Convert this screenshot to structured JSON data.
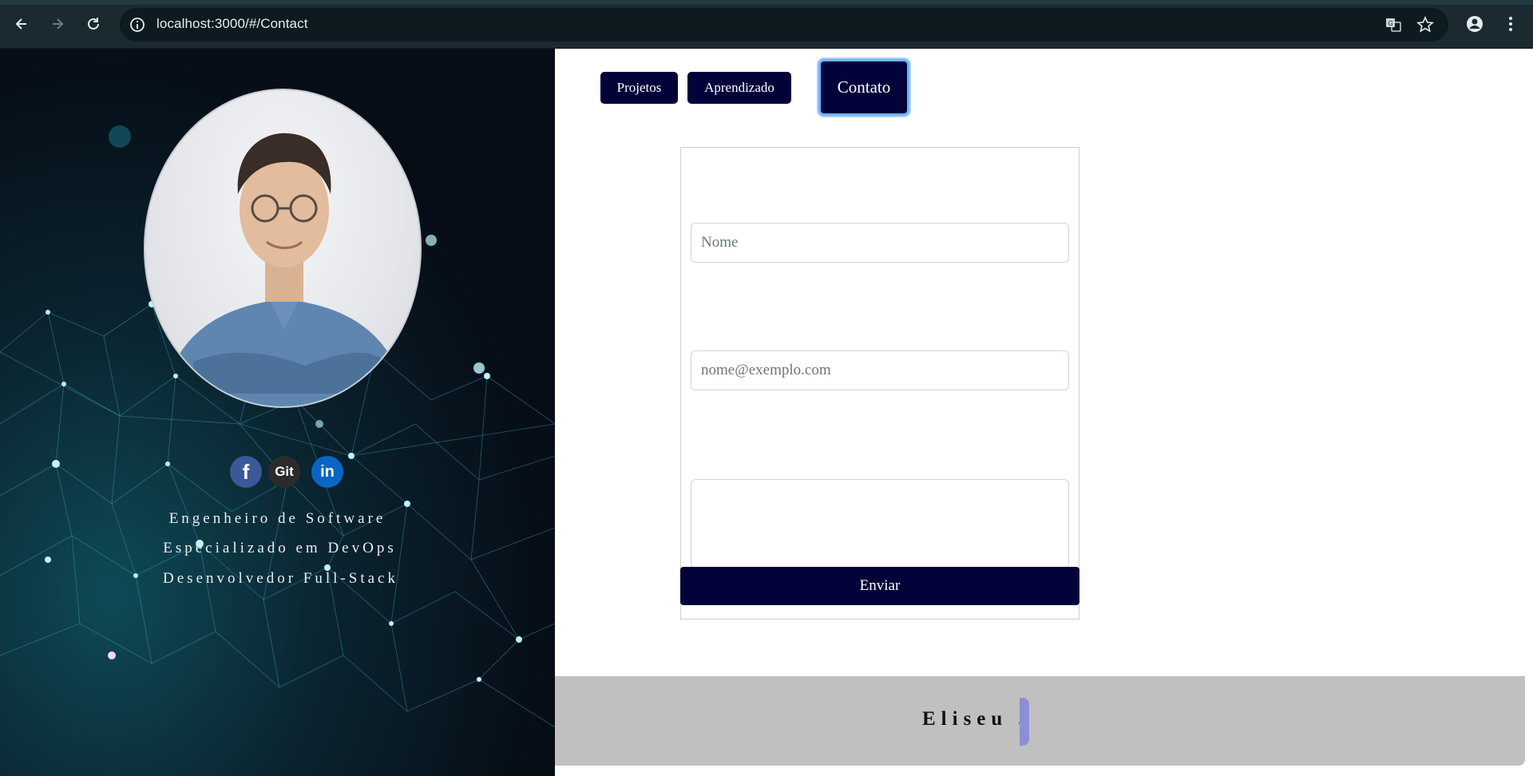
{
  "browser": {
    "url": "localhost:3000/#/Contact",
    "icons": {
      "back": "arrow-left-icon",
      "forward": "arrow-right-icon",
      "reload": "reload-icon",
      "site_info": "info-icon",
      "translate": "translate-icon",
      "bookmark": "star-icon",
      "profile": "person-icon",
      "menu": "kebab-menu-icon"
    }
  },
  "sidebar": {
    "social": [
      {
        "name": "facebook",
        "label": "f",
        "color": "#3b5998"
      },
      {
        "name": "git",
        "label": "Git",
        "color": "#2b2b2b"
      },
      {
        "name": "linkedin",
        "label": "in",
        "color": "#0a66c2"
      }
    ],
    "taglines": [
      "Engenheiro de Software",
      "Especializado em DevOps",
      "Desenvolvedor Full-Stack"
    ]
  },
  "nav": {
    "tabs": [
      {
        "label": "Projetos",
        "active": false
      },
      {
        "label": "Aprendizado",
        "active": false
      },
      {
        "label": "Contato",
        "active": true
      }
    ]
  },
  "form": {
    "name_placeholder": "Nome",
    "email_placeholder": "nome@exemplo.com",
    "message_placeholder": "",
    "submit_label": "Enviar"
  },
  "footer": {
    "name_text": "Eliseu J"
  },
  "colors": {
    "accent": "#03033a",
    "active_outline": "#6fb3ff",
    "footer_bg": "#c0c0c0"
  }
}
